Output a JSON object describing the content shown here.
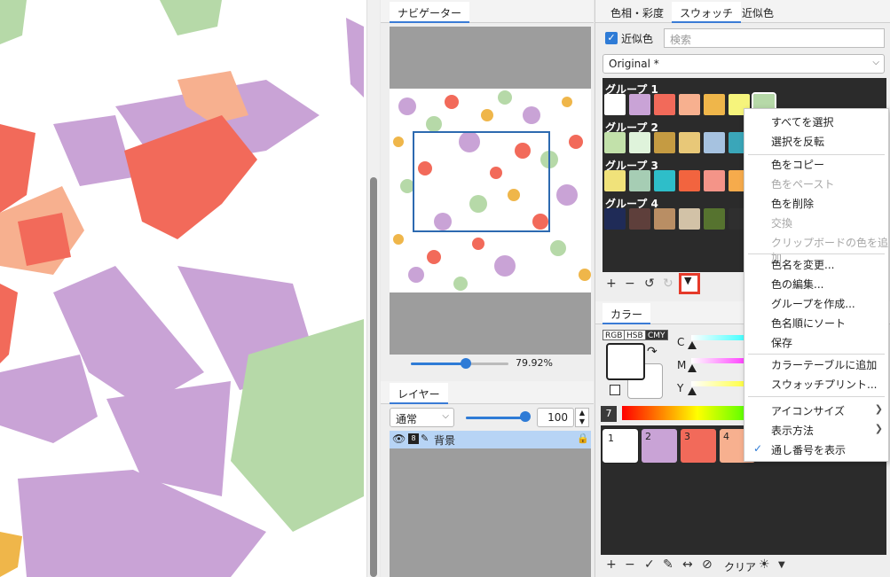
{
  "navigator": {
    "tab": "ナビゲーター",
    "zoom": "79.92%"
  },
  "layer": {
    "tab": "レイヤー",
    "blend_mode": "通常",
    "opacity": "100",
    "layer_name": "背景"
  },
  "right": {
    "tabs": [
      "色相・彩度",
      "スウォッチ",
      "近似色"
    ],
    "similar_label": "近似色",
    "search_placeholder": "検索",
    "dropdown_value": "Original *",
    "groups": [
      {
        "label": "グループ 1",
        "colors": [
          "#ffffff",
          "#c9a3d6",
          "#f26a5a",
          "#f7b08f",
          "#efb64a",
          "#f6f47c",
          "#b6d9a8"
        ]
      },
      {
        "label": "グループ 2",
        "colors": [
          "#c2e1aa",
          "#dff3db",
          "#c59b42",
          "#e8c878",
          "#a6c2e0",
          "#3aa6b9"
        ]
      },
      {
        "label": "グループ 3",
        "colors": [
          "#f0e27a",
          "#a6cdb4",
          "#2ebec9",
          "#f2643f",
          "#f49488",
          "#f6ab4c"
        ]
      },
      {
        "label": "グループ 4",
        "colors": [
          "#1f2b57",
          "#5e3f3b",
          "#b98e64",
          "#d2c2a7",
          "#56732f",
          "#2f2f2f"
        ]
      }
    ],
    "color_tab": "カラー",
    "modes": [
      "RGB",
      "HSB",
      "CMY"
    ],
    "cmy_labels": [
      "C",
      "M",
      "Y"
    ],
    "palette_badge": "7",
    "palette": [
      {
        "num": "1",
        "color": "#ffffff"
      },
      {
        "num": "2",
        "color": "#c9a3d6"
      },
      {
        "num": "3",
        "color": "#f26a5a"
      },
      {
        "num": "4",
        "color": "#f7b08f"
      }
    ],
    "clear_label": "クリア"
  },
  "context_menu": {
    "items": [
      {
        "label": "すべてを選択",
        "enabled": true
      },
      {
        "label": "選択を反転",
        "enabled": true
      },
      {
        "label": "色をコピー",
        "enabled": true
      },
      {
        "label": "色をペースト",
        "enabled": false
      },
      {
        "label": "色を削除",
        "enabled": true
      },
      {
        "label": "交換",
        "enabled": false
      },
      {
        "label": "クリップボードの色を追加",
        "enabled": false
      },
      {
        "label": "色名を変更...",
        "enabled": true
      },
      {
        "label": "色の編集...",
        "enabled": true
      },
      {
        "label": "グループを作成...",
        "enabled": true
      },
      {
        "label": "色名順にソート",
        "enabled": true
      },
      {
        "label": "保存",
        "enabled": true
      },
      {
        "label": "カラーテーブルに追加",
        "enabled": true
      },
      {
        "label": "スウォッチプリント...",
        "enabled": true
      },
      {
        "label": "アイコンサイズ",
        "enabled": true
      },
      {
        "label": "表示方法",
        "enabled": true
      },
      {
        "label": "通し番号を表示",
        "enabled": true,
        "checked": true
      }
    ]
  },
  "colors": {
    "accent": "#2e7bd6",
    "highlight": "#e53a2a",
    "lilac": "#c9a3d6",
    "coral": "#f26a5a",
    "green": "#b6d9a8"
  }
}
